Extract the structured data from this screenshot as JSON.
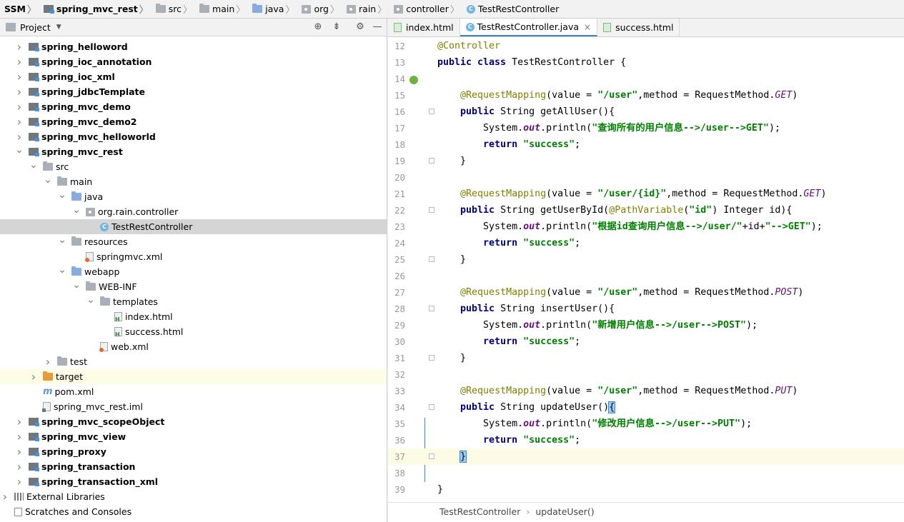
{
  "breadcrumb": [
    {
      "label": "SSM",
      "icon": "none",
      "bold": true
    },
    {
      "label": "spring_mvc_rest",
      "icon": "module-icon",
      "bold": true
    },
    {
      "label": "src",
      "icon": "folder-icon"
    },
    {
      "label": "main",
      "icon": "folder-icon"
    },
    {
      "label": "java",
      "icon": "source-folder-icon"
    },
    {
      "label": "org",
      "icon": "package-icon"
    },
    {
      "label": "rain",
      "icon": "package-icon"
    },
    {
      "label": "controller",
      "icon": "package-icon"
    },
    {
      "label": "TestRestController",
      "icon": "class-icon"
    }
  ],
  "project_panel": {
    "title": "Project",
    "tree": [
      {
        "label": "spring_helloword",
        "depth": 0,
        "arrow": "collapsed",
        "icon": "module",
        "bold": true
      },
      {
        "label": "spring_ioc_annotation",
        "depth": 0,
        "arrow": "collapsed",
        "icon": "module",
        "bold": true
      },
      {
        "label": "spring_ioc_xml",
        "depth": 0,
        "arrow": "collapsed",
        "icon": "module",
        "bold": true
      },
      {
        "label": "spring_jdbcTemplate",
        "depth": 0,
        "arrow": "collapsed",
        "icon": "module",
        "bold": true
      },
      {
        "label": "spring_mvc_demo",
        "depth": 0,
        "arrow": "collapsed",
        "icon": "module",
        "bold": true
      },
      {
        "label": "spring_mvc_demo2",
        "depth": 0,
        "arrow": "collapsed",
        "icon": "module",
        "bold": true
      },
      {
        "label": "spring_mvc_helloworld",
        "depth": 0,
        "arrow": "collapsed",
        "icon": "module",
        "bold": true
      },
      {
        "label": "spring_mvc_rest",
        "depth": 0,
        "arrow": "expanded",
        "icon": "module",
        "bold": true
      },
      {
        "label": "src",
        "depth": 1,
        "arrow": "expanded",
        "icon": "folder"
      },
      {
        "label": "main",
        "depth": 2,
        "arrow": "expanded",
        "icon": "folder"
      },
      {
        "label": "java",
        "depth": 3,
        "arrow": "expanded",
        "icon": "source-folder"
      },
      {
        "label": "org.rain.controller",
        "depth": 4,
        "arrow": "expanded",
        "icon": "package"
      },
      {
        "label": "TestRestController",
        "depth": 5,
        "arrow": "none",
        "icon": "class",
        "selected": true
      },
      {
        "label": "resources",
        "depth": 3,
        "arrow": "expanded",
        "icon": "resources-folder"
      },
      {
        "label": "springmvc.xml",
        "depth": 4,
        "arrow": "none",
        "icon": "xml"
      },
      {
        "label": "webapp",
        "depth": 3,
        "arrow": "expanded",
        "icon": "web-folder"
      },
      {
        "label": "WEB-INF",
        "depth": 4,
        "arrow": "expanded",
        "icon": "folder"
      },
      {
        "label": "templates",
        "depth": 5,
        "arrow": "expanded",
        "icon": "folder"
      },
      {
        "label": "index.html",
        "depth": 6,
        "arrow": "none",
        "icon": "html"
      },
      {
        "label": "success.html",
        "depth": 6,
        "arrow": "none",
        "icon": "html"
      },
      {
        "label": "web.xml",
        "depth": 5,
        "arrow": "none",
        "icon": "xml"
      },
      {
        "label": "test",
        "depth": 2,
        "arrow": "collapsed",
        "icon": "folder"
      },
      {
        "label": "target",
        "depth": 1,
        "arrow": "collapsed",
        "icon": "excluded-folder",
        "highlight": true
      },
      {
        "label": "pom.xml",
        "depth": 1,
        "arrow": "none",
        "icon": "maven"
      },
      {
        "label": "spring_mvc_rest.iml",
        "depth": 1,
        "arrow": "none",
        "icon": "iml"
      },
      {
        "label": "spring_mvc_scopeObject",
        "depth": 0,
        "arrow": "collapsed",
        "icon": "module",
        "bold": true
      },
      {
        "label": "spring_mvc_view",
        "depth": 0,
        "arrow": "collapsed",
        "icon": "module",
        "bold": true
      },
      {
        "label": "spring_proxy",
        "depth": 0,
        "arrow": "collapsed",
        "icon": "module",
        "bold": true
      },
      {
        "label": "spring_transaction",
        "depth": 0,
        "arrow": "collapsed",
        "icon": "module",
        "bold": true
      },
      {
        "label": "spring_transaction_xml",
        "depth": 0,
        "arrow": "collapsed",
        "icon": "module",
        "bold": true
      },
      {
        "label": "External Libraries",
        "depth": -1,
        "arrow": "collapsed",
        "icon": "libraries"
      },
      {
        "label": "Scratches and Consoles",
        "depth": -1,
        "arrow": "none",
        "icon": "scratches"
      }
    ]
  },
  "editor": {
    "tabs": [
      {
        "label": "index.html",
        "icon": "html-icon",
        "active": false
      },
      {
        "label": "TestRestController.java",
        "icon": "class-icon",
        "active": true
      },
      {
        "label": "success.html",
        "icon": "html-icon",
        "active": false
      }
    ],
    "lines": [
      {
        "n": "12",
        "tokens": [
          [
            "an",
            "@Controller"
          ]
        ]
      },
      {
        "n": "13",
        "tokens": [
          [
            "kw",
            "public class "
          ],
          [
            "p",
            "TestRestController {"
          ]
        ]
      },
      {
        "n": "14",
        "tokens": []
      },
      {
        "n": "15",
        "tokens": [
          [
            "p",
            "    "
          ],
          [
            "an",
            "@RequestMapping"
          ],
          [
            "p",
            "(value = "
          ],
          [
            "st",
            "\"/user\""
          ],
          [
            "p",
            ",method = RequestMethod."
          ],
          [
            "en",
            "GET"
          ],
          [
            "p",
            ")"
          ]
        ]
      },
      {
        "n": "16",
        "fold": true,
        "tokens": [
          [
            "p",
            "    "
          ],
          [
            "kw",
            "public "
          ],
          [
            "p",
            "String getAllUser(){"
          ]
        ]
      },
      {
        "n": "17",
        "tokens": [
          [
            "p",
            "        System."
          ],
          [
            "fs",
            "out"
          ],
          [
            "p",
            ".println("
          ],
          [
            "st",
            "\"查询所有的用户信息-->/user-->GET\""
          ],
          [
            "p",
            ");"
          ]
        ]
      },
      {
        "n": "18",
        "tokens": [
          [
            "p",
            "        "
          ],
          [
            "kw",
            "return "
          ],
          [
            "st",
            "\"success\""
          ],
          [
            "p",
            ";"
          ]
        ]
      },
      {
        "n": "19",
        "fold": true,
        "tokens": [
          [
            "p",
            "    }"
          ]
        ]
      },
      {
        "n": "20",
        "tokens": []
      },
      {
        "n": "21",
        "tokens": [
          [
            "p",
            "    "
          ],
          [
            "an",
            "@RequestMapping"
          ],
          [
            "p",
            "(value = "
          ],
          [
            "st",
            "\"/user/{id}\""
          ],
          [
            "p",
            ",method = RequestMethod."
          ],
          [
            "en",
            "GET"
          ],
          [
            "p",
            ")"
          ]
        ]
      },
      {
        "n": "22",
        "fold": true,
        "tokens": [
          [
            "p",
            "    "
          ],
          [
            "kw",
            "public "
          ],
          [
            "p",
            "String getUserById("
          ],
          [
            "an",
            "@PathVariable"
          ],
          [
            "p",
            "("
          ],
          [
            "st",
            "\"id\""
          ],
          [
            "p",
            ") Integer id){"
          ]
        ]
      },
      {
        "n": "23",
        "tokens": [
          [
            "p",
            "        System."
          ],
          [
            "fs",
            "out"
          ],
          [
            "p",
            ".println("
          ],
          [
            "st",
            "\"根据id查询用户信息-->/user/\""
          ],
          [
            "p",
            "+id+"
          ],
          [
            "st",
            "\"-->GET\""
          ],
          [
            "p",
            ");"
          ]
        ]
      },
      {
        "n": "24",
        "tokens": [
          [
            "p",
            "        "
          ],
          [
            "kw",
            "return "
          ],
          [
            "st",
            "\"success\""
          ],
          [
            "p",
            ";"
          ]
        ]
      },
      {
        "n": "25",
        "fold": true,
        "tokens": [
          [
            "p",
            "    }"
          ]
        ]
      },
      {
        "n": "26",
        "tokens": []
      },
      {
        "n": "27",
        "tokens": [
          [
            "p",
            "    "
          ],
          [
            "an",
            "@RequestMapping"
          ],
          [
            "p",
            "(value = "
          ],
          [
            "st",
            "\"/user\""
          ],
          [
            "p",
            ",method = RequestMethod."
          ],
          [
            "en",
            "POST"
          ],
          [
            "p",
            ")"
          ]
        ]
      },
      {
        "n": "28",
        "fold": true,
        "tokens": [
          [
            "p",
            "    "
          ],
          [
            "kw",
            "public "
          ],
          [
            "p",
            "String insertUser(){"
          ]
        ]
      },
      {
        "n": "29",
        "tokens": [
          [
            "p",
            "        System."
          ],
          [
            "fs",
            "out"
          ],
          [
            "p",
            ".println("
          ],
          [
            "st",
            "\"新增用户信息-->/user-->POST\""
          ],
          [
            "p",
            ");"
          ]
        ]
      },
      {
        "n": "30",
        "tokens": [
          [
            "p",
            "        "
          ],
          [
            "kw",
            "return "
          ],
          [
            "st",
            "\"success\""
          ],
          [
            "p",
            ";"
          ]
        ]
      },
      {
        "n": "31",
        "fold": true,
        "tokens": [
          [
            "p",
            "    }"
          ]
        ]
      },
      {
        "n": "32",
        "tokens": []
      },
      {
        "n": "33",
        "tokens": [
          [
            "p",
            "    "
          ],
          [
            "an",
            "@RequestMapping"
          ],
          [
            "p",
            "(value = "
          ],
          [
            "st",
            "\"/user\""
          ],
          [
            "p",
            ",method = RequestMethod."
          ],
          [
            "en",
            "PUT"
          ],
          [
            "p",
            ")"
          ]
        ]
      },
      {
        "n": "34",
        "fold": true,
        "tokens": [
          [
            "p",
            "    "
          ],
          [
            "kw",
            "public "
          ],
          [
            "p",
            "String updateUser()"
          ],
          [
            "bh",
            "{"
          ]
        ]
      },
      {
        "n": "35",
        "tokens": [
          [
            "p",
            "        System."
          ],
          [
            "fs",
            "out"
          ],
          [
            "p",
            ".println("
          ],
          [
            "st",
            "\"修改用户信息-->/user-->PUT\""
          ],
          [
            "p",
            ");"
          ]
        ]
      },
      {
        "n": "36",
        "tokens": [
          [
            "p",
            "        "
          ],
          [
            "kw",
            "return "
          ],
          [
            "st",
            "\"success\""
          ],
          [
            "p",
            ";"
          ]
        ]
      },
      {
        "n": "37",
        "fold": true,
        "current": true,
        "tokens": [
          [
            "p",
            "    "
          ],
          [
            "bh",
            "}"
          ],
          [
            "caret",
            ""
          ]
        ]
      },
      {
        "n": "38",
        "tokens": []
      },
      {
        "n": "39",
        "tokens": [
          [
            "p",
            "}"
          ]
        ]
      }
    ]
  },
  "statusbar": {
    "class_name": "TestRestController",
    "separator": "›",
    "method_name": "updateUser()"
  }
}
